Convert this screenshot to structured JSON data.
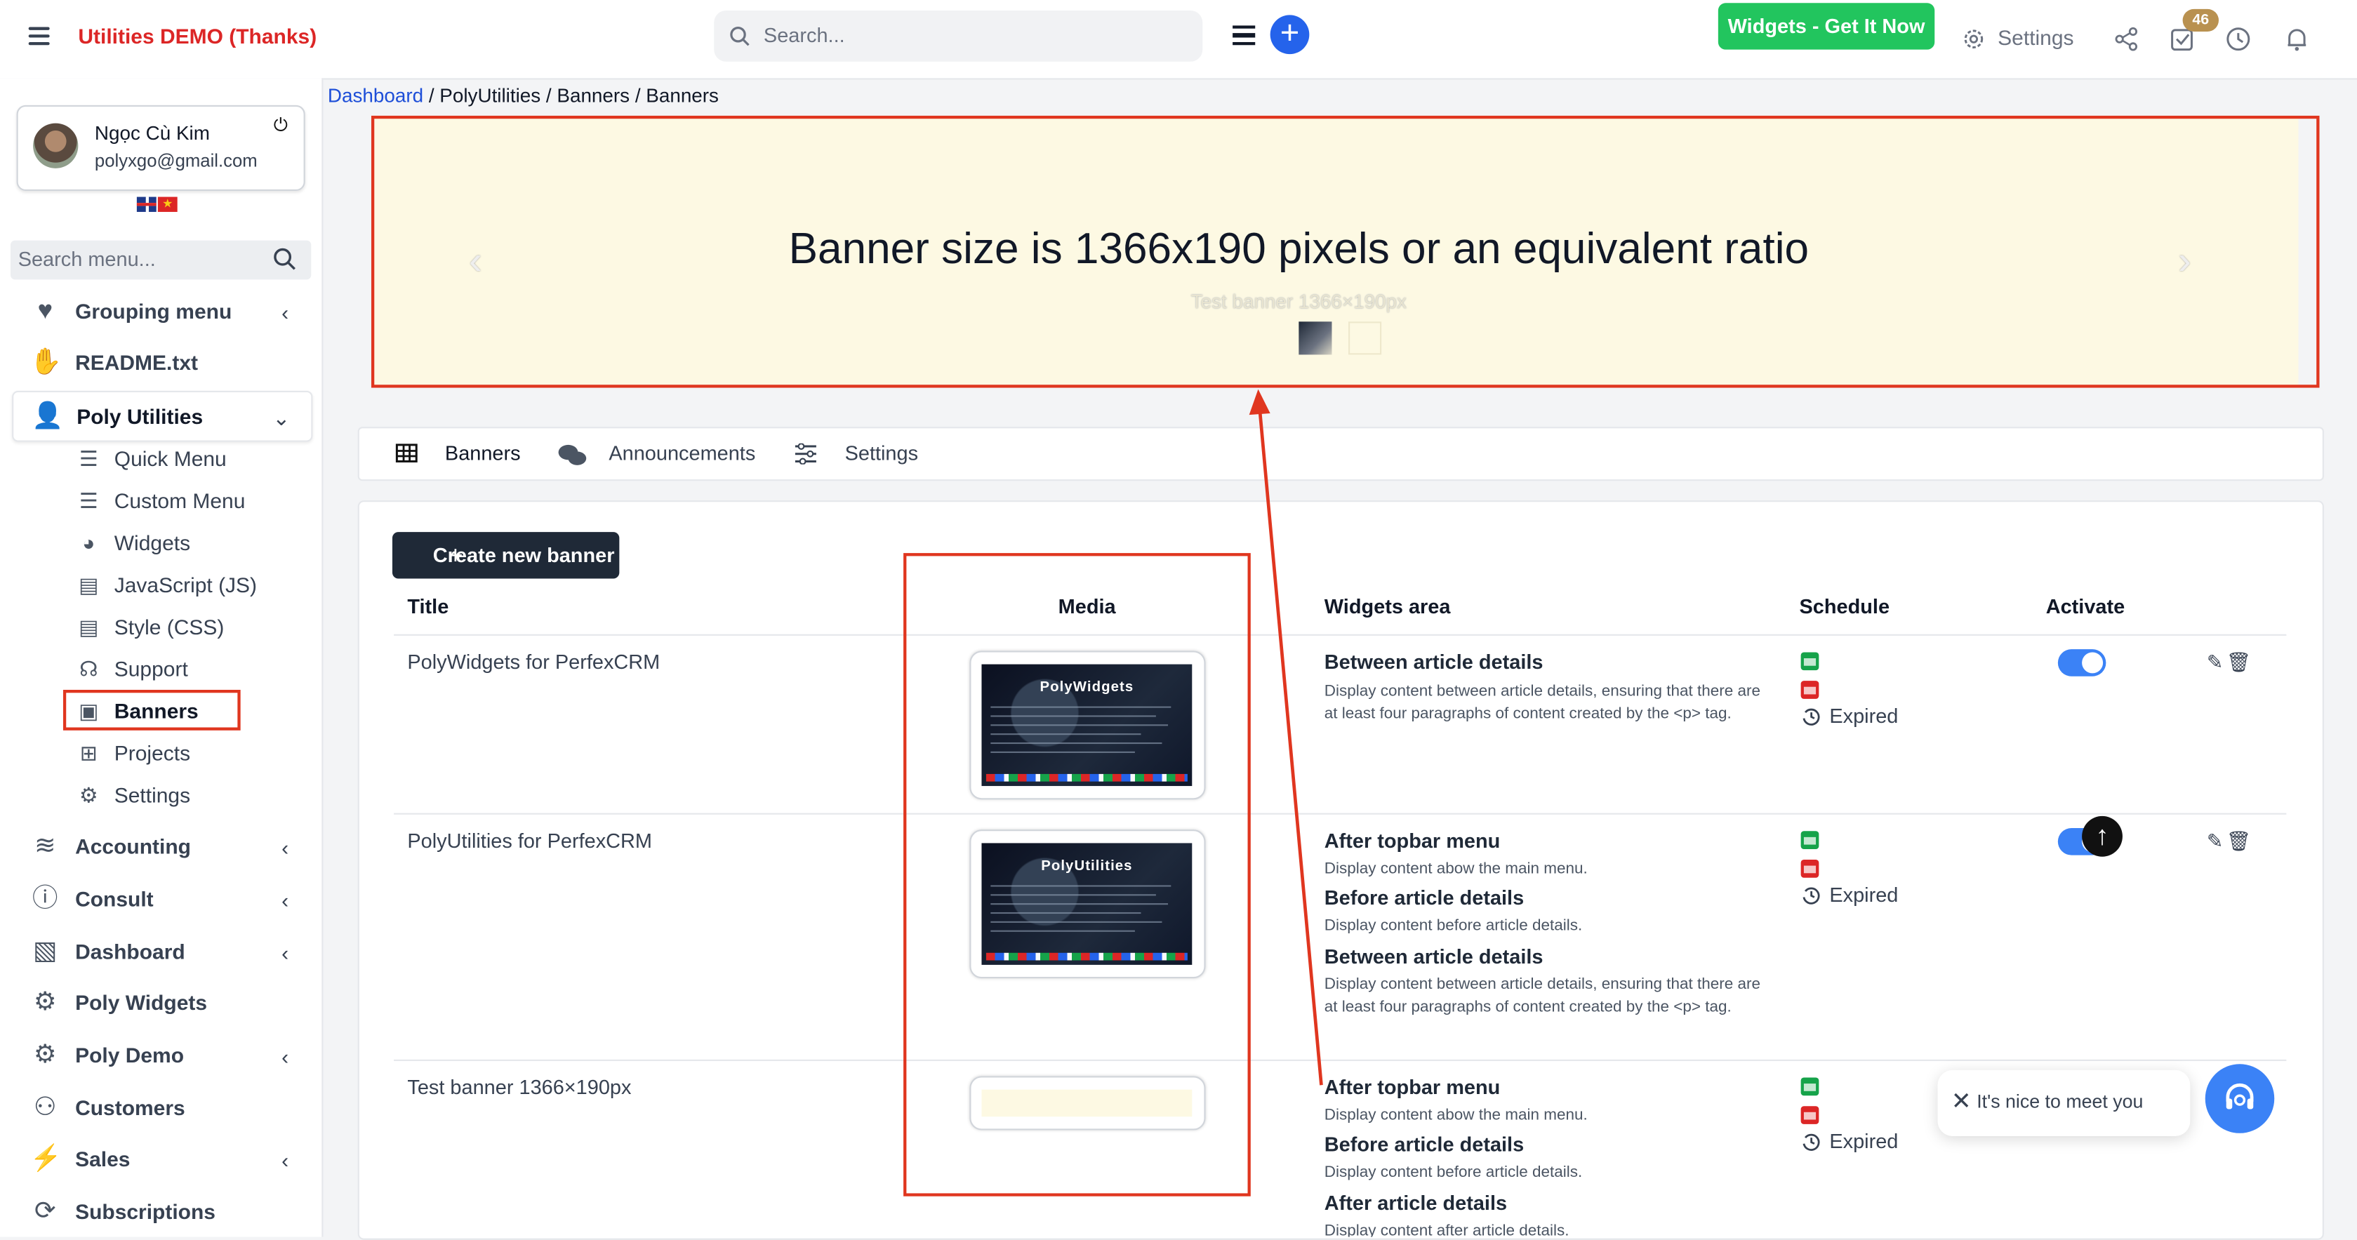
{
  "app": {
    "brand": "Utilities DEMO (Thanks)"
  },
  "header": {
    "search_placeholder": "Search...",
    "cta": "Widgets - Get It Now",
    "settings": "Settings",
    "badge_count": "46"
  },
  "profile": {
    "name": "Ngọc Cù Kim",
    "email": "polyxgo@gmail.com"
  },
  "sidebar": {
    "search_placeholder": "Search menu...",
    "items": [
      {
        "label": "Grouping menu",
        "icon": "heart-icon"
      },
      {
        "label": "README.txt",
        "icon": "hand-holding-icon"
      },
      {
        "label": "Poly Utilities",
        "icon": "user-gear-icon"
      },
      {
        "label": "Accounting",
        "icon": "layers-icon"
      },
      {
        "label": "Consult",
        "icon": "info-circle-icon"
      },
      {
        "label": "Dashboard",
        "icon": "image-icon"
      },
      {
        "label": "Poly Widgets",
        "icon": "gears-icon"
      },
      {
        "label": "Poly Demo",
        "icon": "gears-icon"
      },
      {
        "label": "Customers",
        "icon": "user-icon"
      },
      {
        "label": "Sales",
        "icon": "bolt-icon"
      },
      {
        "label": "Subscriptions",
        "icon": "repeat-icon"
      }
    ],
    "subitems": [
      {
        "label": "Quick Menu"
      },
      {
        "label": "Custom Menu"
      },
      {
        "label": "Widgets"
      },
      {
        "label": "JavaScript (JS)"
      },
      {
        "label": "Style (CSS)"
      },
      {
        "label": "Support"
      },
      {
        "label": "Banners"
      },
      {
        "label": "Projects"
      },
      {
        "label": "Settings"
      }
    ]
  },
  "breadcrumb": {
    "root": "Dashboard",
    "rest": " / PolyUtilities / Banners / Banners"
  },
  "banner": {
    "text": "Banner size is 1366x190 pixels or an equivalent ratio",
    "caption": "Test banner 1366×190px"
  },
  "tabs": [
    "Banners",
    "Announcements",
    "Settings"
  ],
  "table": {
    "create_label": "Create new banner",
    "columns": [
      "Title",
      "Media",
      "Widgets area",
      "Schedule",
      "Activate"
    ],
    "rows": [
      {
        "title": "PolyWidgets for PerfexCRM",
        "media_title": "PolyWidgets",
        "areas": [
          {
            "name": "Between article details",
            "desc": "Display content between article details, ensuring that there are at least four paragraphs of content created by the <p> tag."
          }
        ],
        "status": "Expired"
      },
      {
        "title": "PolyUtilities for PerfexCRM",
        "media_title": "PolyUtilities",
        "areas": [
          {
            "name": "After topbar menu",
            "desc": "Display content abow the main menu."
          },
          {
            "name": "Before article details",
            "desc": "Display content before article details."
          },
          {
            "name": "Between article details",
            "desc": "Display content between article details, ensuring that there are at least four paragraphs of content created by the <p> tag."
          }
        ],
        "status": "Expired"
      },
      {
        "title": "Test banner 1366×190px",
        "areas": [
          {
            "name": "After topbar menu",
            "desc": "Display content abow the main menu."
          },
          {
            "name": "Before article details",
            "desc": "Display content before article details."
          },
          {
            "name": "After article details",
            "desc": "Display content after article details."
          }
        ],
        "status": "Expired"
      }
    ]
  },
  "chat": {
    "message": "It's nice to meet you"
  },
  "colors": {
    "accent": "#2563eb",
    "annotation": "#e0361f",
    "cta": "#22c55e",
    "brand": "#dc2626"
  }
}
